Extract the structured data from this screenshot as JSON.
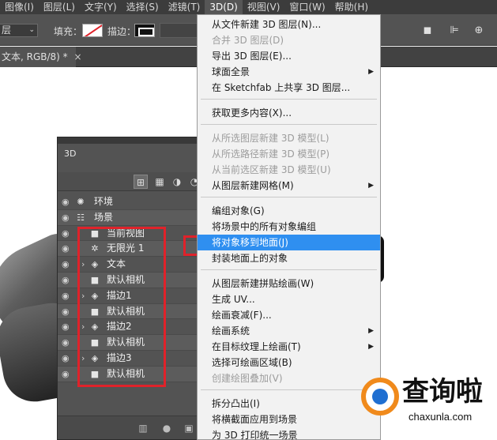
{
  "menubar": {
    "items": [
      "图像(I)",
      "图层(L)",
      "文字(Y)",
      "选择(S)",
      "滤镜(T)",
      "3D(D)",
      "视图(V)",
      "窗口(W)",
      "帮助(H)"
    ],
    "active": "3D(D)"
  },
  "options": {
    "layer_select": "层",
    "fill_label": "填充：",
    "stroke_label": "描边："
  },
  "tab": {
    "label": "文本, RGB/8) *",
    "close": "×"
  },
  "panel": {
    "tab": "3D",
    "rows": [
      {
        "label": "环境",
        "icon": "sun-icon",
        "twisty": false
      },
      {
        "label": "场景",
        "icon": "scene-icon",
        "twisty": false
      },
      {
        "label": "当前视图",
        "icon": "camera-icon",
        "twisty": false
      },
      {
        "label": "无限光 1",
        "icon": "light-icon",
        "twisty": false
      },
      {
        "label": "文本",
        "icon": "mesh-icon",
        "twisty": true
      },
      {
        "label": "默认相机",
        "icon": "camera-icon",
        "twisty": false
      },
      {
        "label": "描边1",
        "icon": "mesh-icon",
        "twisty": true
      },
      {
        "label": "默认相机",
        "icon": "camera-icon",
        "twisty": false
      },
      {
        "label": "描边2",
        "icon": "mesh-icon",
        "twisty": true
      },
      {
        "label": "默认相机",
        "icon": "camera-icon",
        "twisty": false
      },
      {
        "label": "描边3",
        "icon": "mesh-icon",
        "twisty": true
      },
      {
        "label": "默认相机",
        "icon": "camera-icon",
        "twisty": false
      }
    ]
  },
  "menu": {
    "items": [
      {
        "label": "从文件新建 3D 图层(N)...",
        "disabled": false,
        "sub": false
      },
      {
        "label": "合并 3D 图层(D)",
        "disabled": true,
        "sub": false
      },
      {
        "label": "导出 3D 图层(E)...",
        "disabled": false,
        "sub": false
      },
      {
        "label": "球面全景",
        "disabled": false,
        "sub": true
      },
      {
        "label": "在 Sketchfab 上共享 3D 图层...",
        "disabled": false,
        "sub": false
      },
      {
        "label": "获取更多内容(X)...",
        "disabled": false,
        "sub": false
      },
      {
        "label": "从所选图层新建 3D 模型(L)",
        "disabled": true,
        "sub": false
      },
      {
        "label": "从所选路径新建 3D 模型(P)",
        "disabled": true,
        "sub": false
      },
      {
        "label": "从当前选区新建 3D 模型(U)",
        "disabled": true,
        "sub": false
      },
      {
        "label": "从图层新建网格(M)",
        "disabled": false,
        "sub": true
      },
      {
        "label": "编组对象(G)",
        "disabled": false,
        "sub": false
      },
      {
        "label": "将场景中的所有对象编组",
        "disabled": false,
        "sub": false
      },
      {
        "label": "将对象移到地面(J)",
        "disabled": false,
        "sub": false,
        "highlighted": true
      },
      {
        "label": "封装地面上的对象",
        "disabled": false,
        "sub": false
      },
      {
        "label": "从图层新建拼贴绘画(W)",
        "disabled": false,
        "sub": false
      },
      {
        "label": "生成 UV...",
        "disabled": false,
        "sub": false
      },
      {
        "label": "绘画衰减(F)...",
        "disabled": false,
        "sub": false
      },
      {
        "label": "绘画系统",
        "disabled": false,
        "sub": true
      },
      {
        "label": "在目标纹理上绘画(T)",
        "disabled": false,
        "sub": true
      },
      {
        "label": "选择可绘画区域(B)",
        "disabled": false,
        "sub": false
      },
      {
        "label": "创建绘图叠加(V)",
        "disabled": true,
        "sub": false
      },
      {
        "label": "拆分凸出(I)",
        "disabled": false,
        "sub": false
      },
      {
        "label": "将横截面应用到场景",
        "disabled": false,
        "sub": false
      },
      {
        "label": "为 3D 打印统一场景",
        "disabled": false,
        "sub": false
      }
    ]
  },
  "watermark": {
    "title": "查询啦",
    "url": "chaxunla.com"
  },
  "colors": {
    "highlight": "#2f8ff0",
    "redbox": "#e0222a"
  }
}
